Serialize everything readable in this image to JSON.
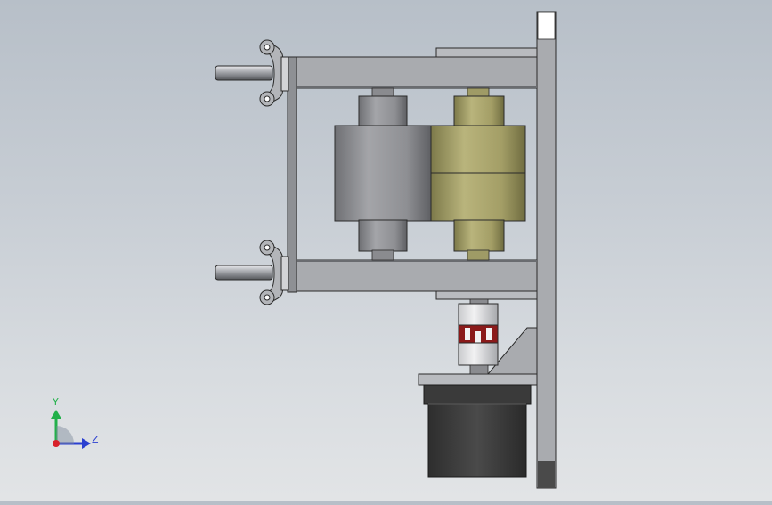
{
  "viewport": {
    "background_top": "#b7bfc8",
    "background_bottom": "#e2e4e6"
  },
  "triad": {
    "y_label": "Y",
    "z_label": "Z",
    "y_color": "#22b04a",
    "z_color": "#2a3fd0",
    "x_color": "#d8202a"
  },
  "colors": {
    "frame_plate": "#a9abaf",
    "roller_gray": "#8f9094",
    "roller_olive": "#a8a36a",
    "motor_body": "#3c3c3c",
    "coupling_red": "#8b1a1a"
  }
}
